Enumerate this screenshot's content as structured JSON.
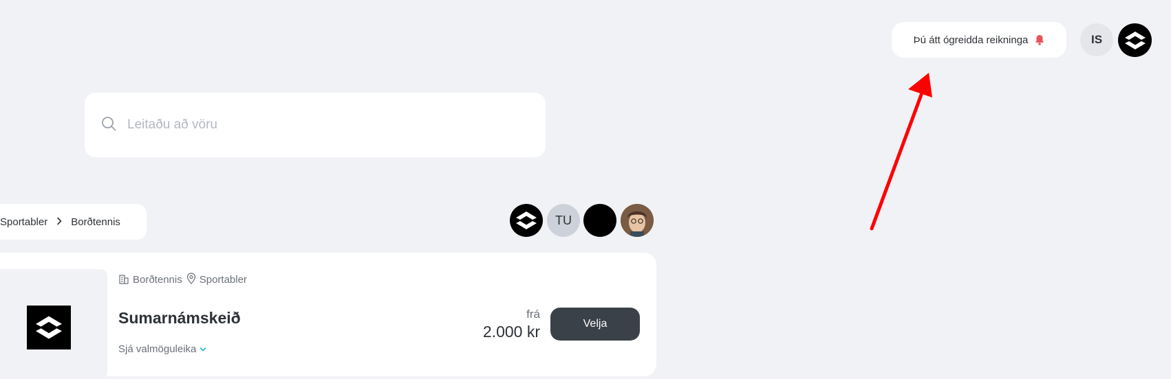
{
  "header": {
    "notice_label": "Þú átt ógreidda reikninga",
    "user_initials": "IS"
  },
  "search": {
    "placeholder": "Leitaðu að vöru",
    "value": ""
  },
  "breadcrumb": {
    "items": [
      "Sportabler",
      "Borðtennis"
    ]
  },
  "participants": {
    "initials": "TU"
  },
  "product": {
    "category": "Borðtennis",
    "organizer": "Sportabler",
    "title": "Sumarnámskeið",
    "options_label": "Sjá valmöguleika",
    "price_prefix": "frá",
    "price": "2.000 kr",
    "select_label": "Velja"
  },
  "colors": {
    "background": "#f1f2f5",
    "button": "#3a4148",
    "bell": "#e8545a",
    "accent": "#1cb5c9",
    "annotation": "#ff0000"
  }
}
